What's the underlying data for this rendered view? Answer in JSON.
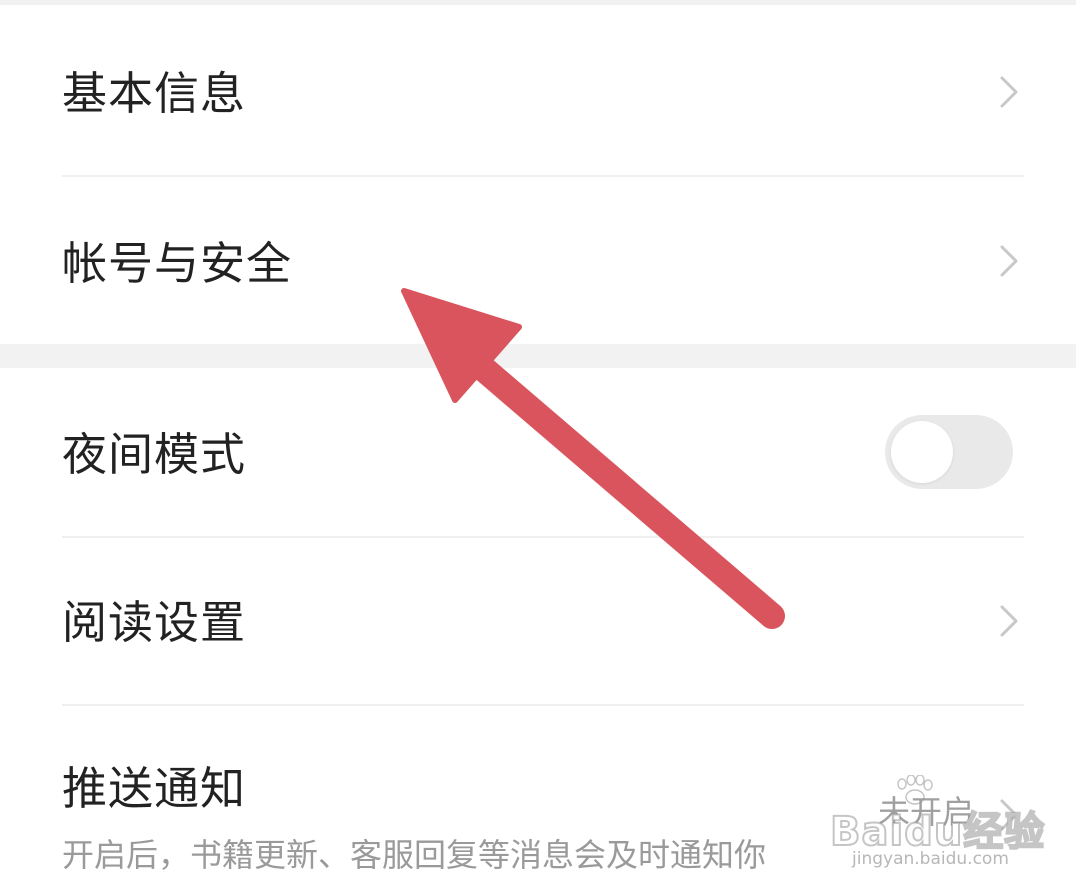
{
  "settings": {
    "items": [
      {
        "label": "基本信息"
      },
      {
        "label": "帐号与安全"
      },
      {
        "label": "夜间模式",
        "toggle_on": false
      },
      {
        "label": "阅读设置"
      },
      {
        "label": "推送通知",
        "status": "未开启",
        "description": "开启后，书籍更新、客服回复等消息会及时通知你"
      }
    ]
  },
  "watermark": {
    "main": "Baidu经验",
    "sub": "jingyan.baidu.com"
  },
  "colors": {
    "background": "#ffffff",
    "section_gap": "#f2f2f2",
    "divider": "#efefef",
    "label_text": "#222222",
    "secondary_text": "#9a9a9a",
    "chevron": "#c8c8c8",
    "toggle_off": "#e9e9e9",
    "annotation_arrow": "#d9545c"
  },
  "icons": {
    "row_chevron": "chevron-right-icon",
    "annotation": "arrow-pointer-icon"
  }
}
